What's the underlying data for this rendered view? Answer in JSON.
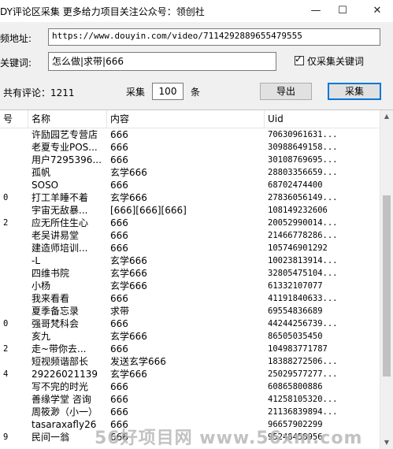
{
  "window": {
    "title": "DY评论区采集   更多给力项目关注公众号：领创社",
    "minimize_glyph": "—",
    "maximize_glyph": "☐",
    "close_glyph": "✕"
  },
  "form": {
    "url_label": "频地址:",
    "url_value": "https://www.douyin.com/video/7114292889655479555",
    "keyword_label": "关键词:",
    "keyword_value": "怎么做|求带|666",
    "only_keyword_label": "仅采集关键词",
    "only_keyword_checked": true,
    "total_comments_label": "共有评论：1211",
    "collect_label": "采集",
    "collect_count": "100",
    "unit_label": "条",
    "export_button": "导出",
    "collect_button": "采集"
  },
  "table": {
    "columns": [
      "号",
      "名称",
      "内容",
      "Uid"
    ],
    "rows": [
      {
        "idx": "",
        "name": "许励园艺专营店",
        "content": "666",
        "uid": "70630961631..."
      },
      {
        "idx": "",
        "name": "老夏专业POS...",
        "content": "666",
        "uid": "30988649158..."
      },
      {
        "idx": "",
        "name": "用户7295396...",
        "content": "666",
        "uid": "30108769695..."
      },
      {
        "idx": "",
        "name": "孤帆",
        "content": "玄学666",
        "uid": "28803356659..."
      },
      {
        "idx": "",
        "name": "SOSO",
        "content": "666",
        "uid": "68702474400"
      },
      {
        "idx": "0",
        "name": "打工羊睡不着",
        "content": "玄学666",
        "uid": "27836056149..."
      },
      {
        "idx": "",
        "name": "宇宙无敌暴...",
        "content": "[666][666][666]",
        "uid": "108149232606"
      },
      {
        "idx": "2",
        "name": "应无所住生心",
        "content": "666",
        "uid": "20052990014..."
      },
      {
        "idx": "",
        "name": "老吴讲易堂",
        "content": "666",
        "uid": "21466778286..."
      },
      {
        "idx": "",
        "name": "建造师培训...",
        "content": "666",
        "uid": "105746901292"
      },
      {
        "idx": "",
        "name": "-L",
        "content": "玄学666",
        "uid": "10023813914..."
      },
      {
        "idx": "",
        "name": "四维书院",
        "content": "玄学666",
        "uid": "32805475104..."
      },
      {
        "idx": "",
        "name": "小杨",
        "content": "玄学666",
        "uid": "61332107077"
      },
      {
        "idx": "",
        "name": "我来看看",
        "content": "666",
        "uid": "41191840633..."
      },
      {
        "idx": "",
        "name": "夏季备忘录",
        "content": "求带",
        "uid": "69554836689"
      },
      {
        "idx": "0",
        "name": "强哥梵科会",
        "content": "666",
        "uid": "44244256739..."
      },
      {
        "idx": "",
        "name": "亥九",
        "content": "玄学666",
        "uid": "86505035450"
      },
      {
        "idx": "2",
        "name": "走~带你去...",
        "content": "666",
        "uid": "104983771787"
      },
      {
        "idx": "",
        "name": "短视频谐部长",
        "content": "发送玄学666",
        "uid": "18388272506..."
      },
      {
        "idx": "4",
        "name": "29226021139",
        "content": "玄学666",
        "uid": "25029577277..."
      },
      {
        "idx": "",
        "name": "写不完的时光",
        "content": "666",
        "uid": "60865800886"
      },
      {
        "idx": "",
        "name": "善缘学堂 咨询",
        "content": "666",
        "uid": "41258105320..."
      },
      {
        "idx": "",
        "name": "周筱渺（小一）",
        "content": "666",
        "uid": "21136839894..."
      },
      {
        "idx": "",
        "name": "tasaraxafly26",
        "content": "666",
        "uid": "96657902299"
      },
      {
        "idx": "9",
        "name": "民间一翁",
        "content": "666",
        "uid": "95248458956"
      }
    ]
  },
  "scrollbar": {
    "up_glyph": "▲",
    "down_glyph": "▼",
    "position": 0.55
  },
  "watermark": "56好项目网 www.56xm.com"
}
